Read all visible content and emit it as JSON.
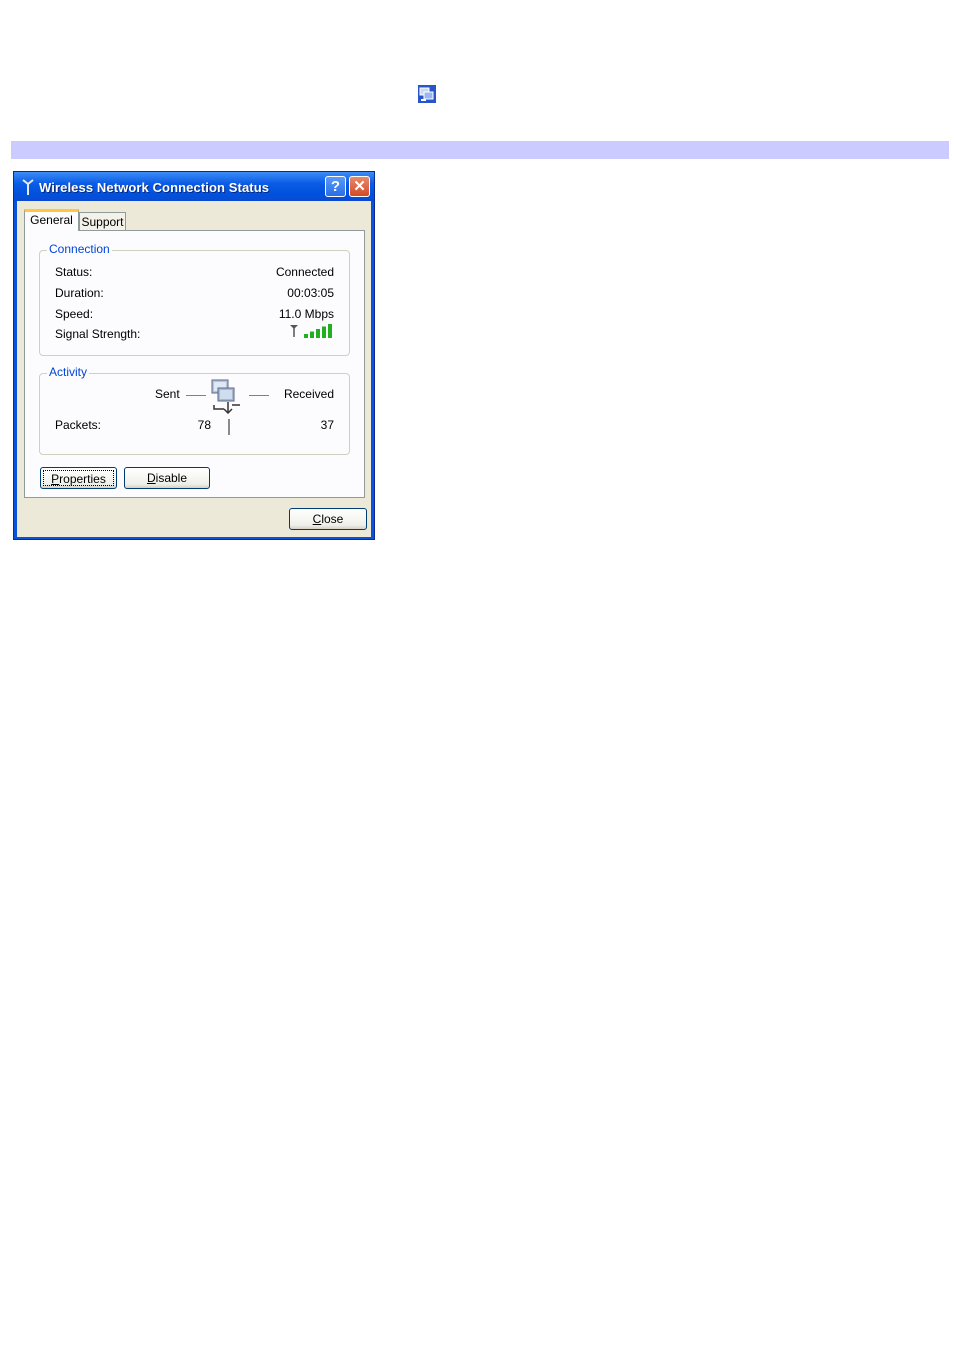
{
  "window": {
    "title": "Wireless Network Connection Status",
    "help_label": "?",
    "close_glyph": "✕"
  },
  "tabs": [
    {
      "label": "General",
      "selected": true
    },
    {
      "label": "Support",
      "selected": false
    }
  ],
  "connection": {
    "group_title": "Connection",
    "rows": [
      {
        "label": "Status:",
        "value": "Connected"
      },
      {
        "label": "Duration:",
        "value": "00:03:05"
      },
      {
        "label": "Speed:",
        "value": "11.0 Mbps"
      },
      {
        "label": "Signal Strength:",
        "value": ""
      }
    ],
    "signal_bars_lit": 5,
    "signal_bars_total": 5
  },
  "activity": {
    "group_title": "Activity",
    "sent_label": "Sent",
    "received_label": "Received",
    "packets_label": "Packets:",
    "packets_sent": "78",
    "packets_received": "37"
  },
  "buttons": {
    "properties": {
      "first": "P",
      "rest": "roperties"
    },
    "disable": {
      "first": "D",
      "rest": "isable"
    },
    "close": {
      "first": "C",
      "rest": "lose"
    }
  },
  "icons": {
    "tray": "network-tray-icon",
    "title": "antenna-icon",
    "activity": "network-computers-icon",
    "signal": "signal-strength-icon"
  },
  "colors": {
    "title_bar": "#0a52d8",
    "band": "#cbcbff",
    "group_title": "#0046d5",
    "signal_green": "#22b022"
  }
}
